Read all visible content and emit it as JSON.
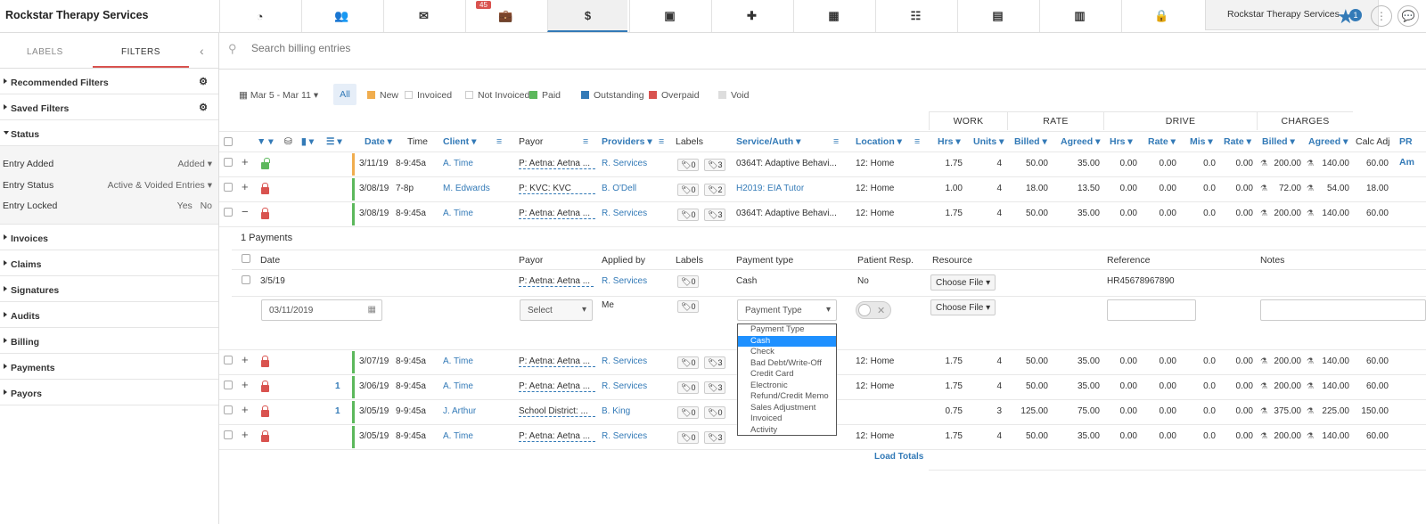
{
  "app": {
    "brand": "Rockstar Therapy Services",
    "org_name": "Rockstar Therapy Services",
    "notif_count": "1",
    "nav_badge": "45"
  },
  "nav": [
    {
      "icon": "dashboard-icon"
    },
    {
      "icon": "users-icon"
    },
    {
      "icon": "envelope-icon"
    },
    {
      "icon": "briefcase-icon"
    },
    {
      "icon": "dollar-icon"
    },
    {
      "icon": "payment-icon"
    },
    {
      "icon": "plus-square-icon"
    },
    {
      "icon": "calendar-icon"
    },
    {
      "icon": "tasks-icon"
    },
    {
      "icon": "book-icon"
    },
    {
      "icon": "chart-icon"
    },
    {
      "icon": "lock-icon"
    }
  ],
  "sidebar": {
    "tab_labels": "LABELS",
    "tab_filters": "FILTERS",
    "recommended": "Recommended Filters",
    "saved": "Saved Filters",
    "status": "Status",
    "entry_added": "Entry Added",
    "entry_added_val": "Added",
    "entry_status": "Entry Status",
    "entry_status_val": "Active & Voided Entries",
    "entry_locked": "Entry Locked",
    "yes": "Yes",
    "no": "No",
    "sections": [
      "Invoices",
      "Claims",
      "Signatures",
      "Audits",
      "Billing",
      "Payments",
      "Payors"
    ]
  },
  "search": {
    "placeholder": "Search billing entries"
  },
  "legend": {
    "date_range": "Mar 5 - Mar 11",
    "all": "All",
    "items": [
      {
        "label": "New",
        "color": "#f0ad4e"
      },
      {
        "label": "Invoiced",
        "color": "#ffffff"
      },
      {
        "label": "Not Invoiced",
        "color": "#ffffff"
      },
      {
        "label": "Paid",
        "color": "#5cb85c"
      },
      {
        "label": "Outstanding",
        "color": "#337ab7"
      },
      {
        "label": "Overpaid",
        "color": "#d9534f"
      },
      {
        "label": "Void",
        "color": "#dddddd"
      }
    ]
  },
  "groups": {
    "work": "WORK",
    "rate": "RATE",
    "drive": "DRIVE",
    "charges": "CHARGES"
  },
  "headers": {
    "date": "Date",
    "time": "Time",
    "client": "Client",
    "payor": "Payor",
    "providers": "Providers",
    "labels": "Labels",
    "service": "Service/Auth",
    "location": "Location",
    "hrs": "Hrs",
    "units": "Units",
    "billed": "Billed",
    "agreed": "Agreed",
    "dhrs": "Hrs",
    "drate": "Rate",
    "mis": "Mis",
    "rate2": "Rate",
    "cbilled": "Billed",
    "cagreed": "Agreed",
    "calcadj": "Calc Adj",
    "pram": "PR Am"
  },
  "rows": [
    {
      "date": "3/11/19",
      "time": "8-9:45a",
      "client": "A. Time",
      "payor": "P: Aetna: Aetna ...",
      "provider": "R. Services",
      "tag1": "0",
      "tag2": "3",
      "service": "0364T: Adaptive Behavi...",
      "location": "12: Home",
      "hrs": "1.75",
      "units": "4",
      "billed": "50.00",
      "agreed": "35.00",
      "dhrs": "0.00",
      "drate": "0.00",
      "mis": "0.0",
      "rate2": "0.00",
      "cbilled": "200.00",
      "cagreed": "140.00",
      "calcadj": "60.00",
      "color": "#f0ad4e",
      "lock": "green",
      "expand": "+",
      "num": ""
    },
    {
      "date": "3/08/19",
      "time": "7-8p",
      "client": "M. Edwards",
      "payor": "P: KVC: KVC",
      "provider": "B. O'Dell",
      "tag1": "0",
      "tag2": "2",
      "service": "H2019: EIA Tutor",
      "location": "12: Home",
      "hrs": "1.00",
      "units": "4",
      "billed": "18.00",
      "agreed": "13.50",
      "dhrs": "0.00",
      "drate": "0.00",
      "mis": "0.0",
      "rate2": "0.00",
      "cbilled": "72.00",
      "cagreed": "54.00",
      "calcadj": "18.00",
      "color": "#5cb85c",
      "lock": "red",
      "expand": "+",
      "num": ""
    },
    {
      "date": "3/08/19",
      "time": "8-9:45a",
      "client": "A. Time",
      "payor": "P: Aetna: Aetna ...",
      "provider": "R. Services",
      "tag1": "0",
      "tag2": "3",
      "service": "0364T: Adaptive Behavi...",
      "location": "12: Home",
      "hrs": "1.75",
      "units": "4",
      "billed": "50.00",
      "agreed": "35.00",
      "dhrs": "0.00",
      "drate": "0.00",
      "mis": "0.0",
      "rate2": "0.00",
      "cbilled": "200.00",
      "cagreed": "140.00",
      "calcadj": "60.00",
      "color": "#5cb85c",
      "lock": "red",
      "expand": "−",
      "num": ""
    }
  ],
  "rows2": [
    {
      "date": "3/07/19",
      "time": "8-9:45a",
      "client": "A. Time",
      "payor": "P: Aetna: Aetna ...",
      "provider": "R. Services",
      "tag1": "0",
      "tag2": "3",
      "location": "12: Home",
      "hrs": "1.75",
      "units": "4",
      "billed": "50.00",
      "agreed": "35.00",
      "dhrs": "0.00",
      "drate": "0.00",
      "mis": "0.0",
      "rate2": "0.00",
      "cbilled": "200.00",
      "cagreed": "140.00",
      "calcadj": "60.00",
      "color": "#5cb85c",
      "lock": "red",
      "expand": "+",
      "num": ""
    },
    {
      "date": "3/06/19",
      "time": "8-9:45a",
      "client": "A. Time",
      "payor": "P: Aetna: Aetna ...",
      "provider": "R. Services",
      "tag1": "0",
      "tag2": "3",
      "location": "12: Home",
      "hrs": "1.75",
      "units": "4",
      "billed": "50.00",
      "agreed": "35.00",
      "dhrs": "0.00",
      "drate": "0.00",
      "mis": "0.0",
      "rate2": "0.00",
      "cbilled": "200.00",
      "cagreed": "140.00",
      "calcadj": "60.00",
      "color": "#5cb85c",
      "lock": "red",
      "expand": "+",
      "num": "1"
    },
    {
      "date": "3/05/19",
      "time": "9-9:45a",
      "client": "J. Arthur",
      "payor": "School District: ...",
      "provider": "B. King",
      "tag1": "0",
      "tag2": "0",
      "location": "",
      "hrs": "0.75",
      "units": "3",
      "billed": "125.00",
      "agreed": "75.00",
      "dhrs": "0.00",
      "drate": "0.00",
      "mis": "0.0",
      "rate2": "0.00",
      "cbilled": "375.00",
      "cagreed": "225.00",
      "calcadj": "150.00",
      "color": "#5cb85c",
      "lock": "red",
      "expand": "+",
      "num": "1"
    },
    {
      "date": "3/05/19",
      "time": "8-9:45a",
      "client": "A. Time",
      "payor": "P: Aetna: Aetna ...",
      "provider": "R. Services",
      "tag1": "0",
      "tag2": "3",
      "location": "12: Home",
      "hrs": "1.75",
      "units": "4",
      "billed": "50.00",
      "agreed": "35.00",
      "dhrs": "0.00",
      "drate": "0.00",
      "mis": "0.0",
      "rate2": "0.00",
      "cbilled": "200.00",
      "cagreed": "140.00",
      "calcadj": "60.00",
      "color": "#5cb85c",
      "lock": "red",
      "expand": "+",
      "num": ""
    }
  ],
  "payments": {
    "title": "1 Payments",
    "h_date": "Date",
    "h_payor": "Payor",
    "h_applied": "Applied by",
    "h_labels": "Labels",
    "h_type": "Payment type",
    "h_resp": "Patient Resp.",
    "h_resource": "Resource",
    "h_ref": "Reference",
    "h_notes": "Notes",
    "row": {
      "date": "3/5/19",
      "payor": "P: Aetna: Aetna ...",
      "applied": "R. Services",
      "tag": "0",
      "type": "Cash",
      "resp": "No",
      "resource": "Choose File",
      "ref": "HR45678967890"
    },
    "new": {
      "date": "03/11/2019",
      "payor": "Select",
      "applied": "Me",
      "tag": "0",
      "type": "Payment Type",
      "resource": "Choose File"
    }
  },
  "dropdown": {
    "options": [
      "Payment Type",
      "Cash",
      "Check",
      "Bad Debt/Write-Off",
      "Credit Card",
      "Electronic",
      "Refund/Credit Memo",
      "Sales Adjustment",
      "Invoiced",
      "Activity"
    ],
    "selected": "Cash"
  },
  "load_totals": "Load Totals"
}
